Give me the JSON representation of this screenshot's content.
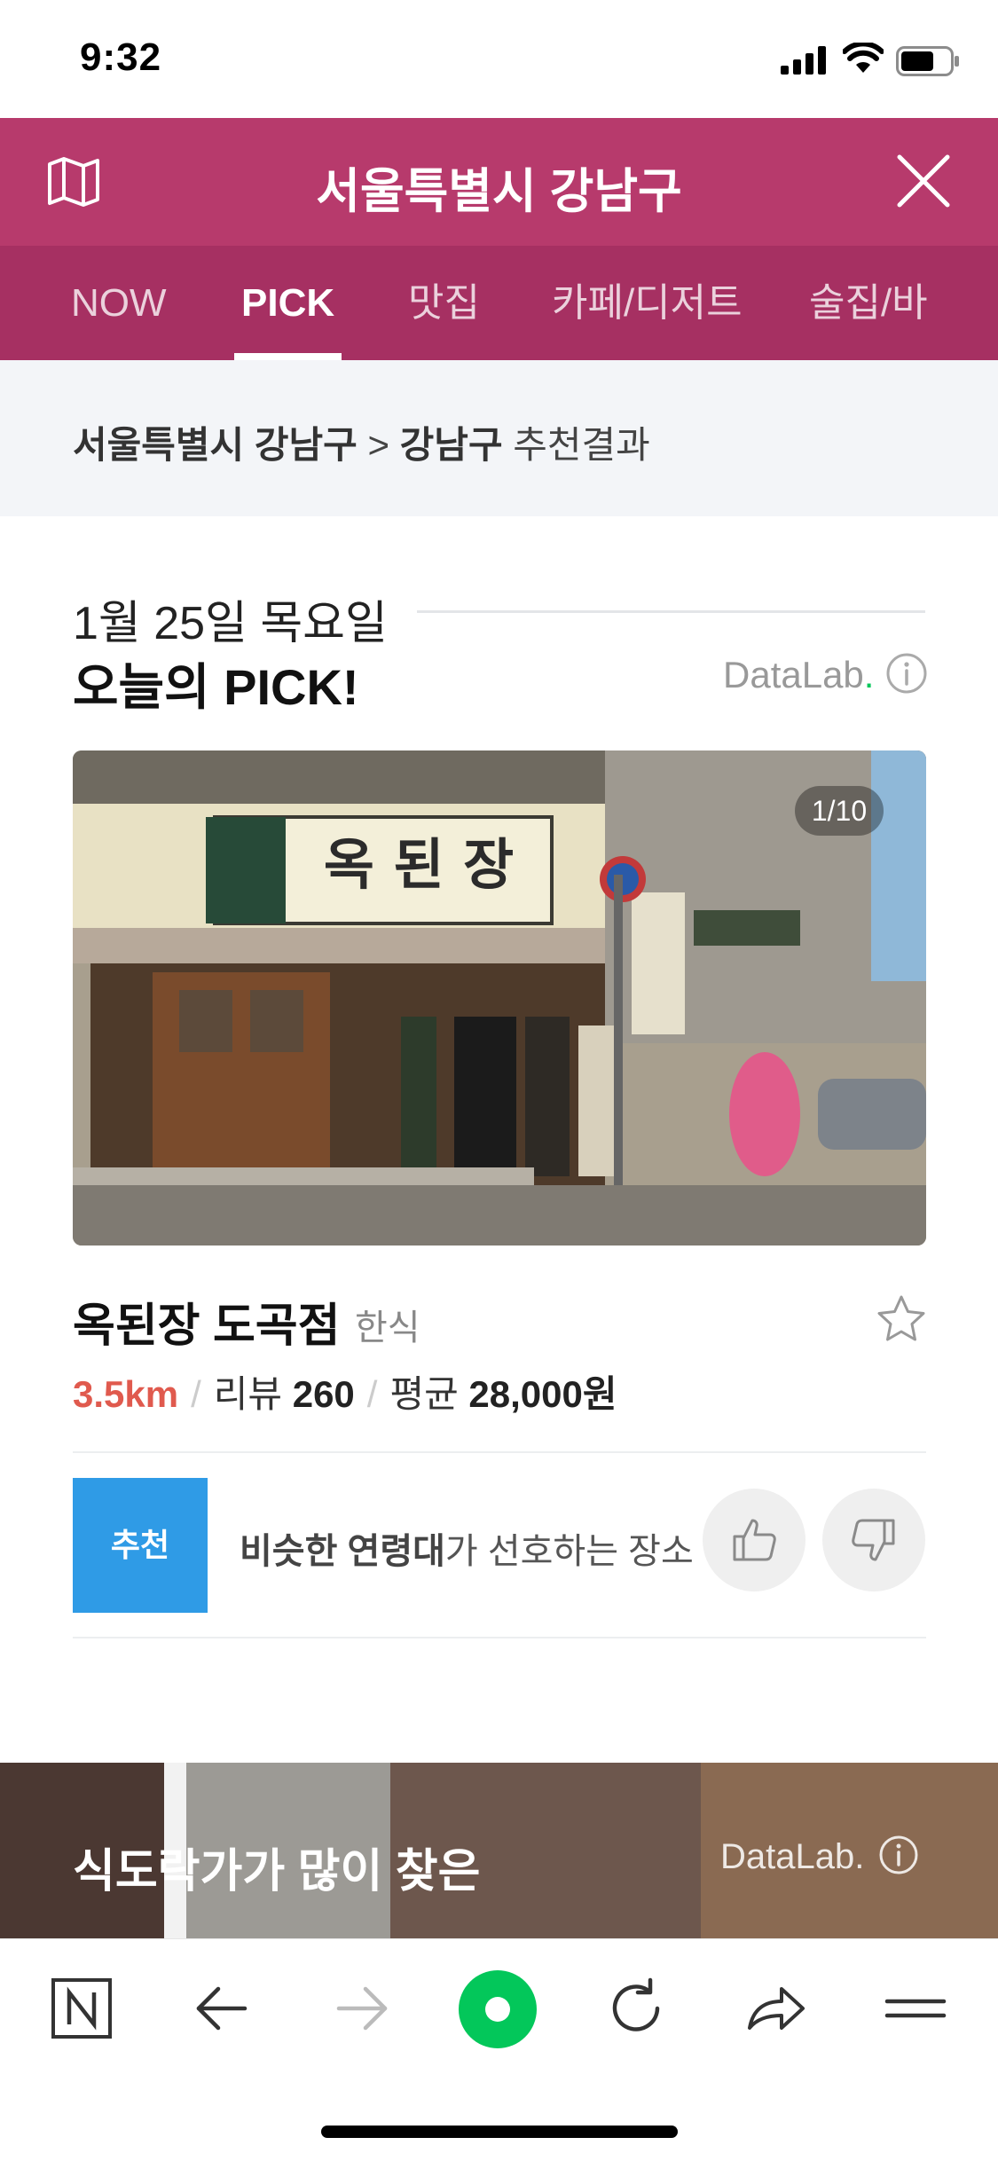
{
  "status_bar": {
    "time": "9:32"
  },
  "header": {
    "title": "서울특별시 강남구"
  },
  "tabs": [
    {
      "label": "NOW",
      "active": false
    },
    {
      "label": "PICK",
      "active": true
    },
    {
      "label": "맛집",
      "active": false
    },
    {
      "label": "카페/디저트",
      "active": false
    },
    {
      "label": "술집/바",
      "active": false
    }
  ],
  "breadcrumb": {
    "region": "서울특별시 강남구",
    "arrow": ">",
    "area": "강남구",
    "suffix": "추천결과"
  },
  "pick": {
    "date": "1월 25일 목요일",
    "title": "오늘의 PICK!",
    "source": "DataLab",
    "source_dot": ".",
    "pager": "1/10"
  },
  "place": {
    "name": "옥된장 도곡점",
    "category": "한식",
    "distance": "3.5km",
    "review_label": "리뷰",
    "review_count": "260",
    "price_label": "평균",
    "price": "28,000원",
    "sep": "/"
  },
  "recommend": {
    "badge": "추천",
    "text_bold": "비슷한 연령대",
    "text_rest": "가 선호하는 장소"
  },
  "banner2": {
    "title": "식도락가가 많이 찾은",
    "source": "DataLab."
  },
  "colors": {
    "header": "#b73a6c",
    "tabs": "#a63062",
    "badge": "#2f9be6",
    "distance": "#e05a4e",
    "naver_green": "#03c75a"
  },
  "icons": [
    "map-icon",
    "close-icon",
    "info-icon",
    "star-icon",
    "thumbs-up-icon",
    "thumbs-down-icon",
    "naver-home-icon",
    "back-arrow-icon",
    "forward-arrow-icon",
    "green-dot-icon",
    "refresh-icon",
    "share-icon",
    "menu-icon"
  ]
}
